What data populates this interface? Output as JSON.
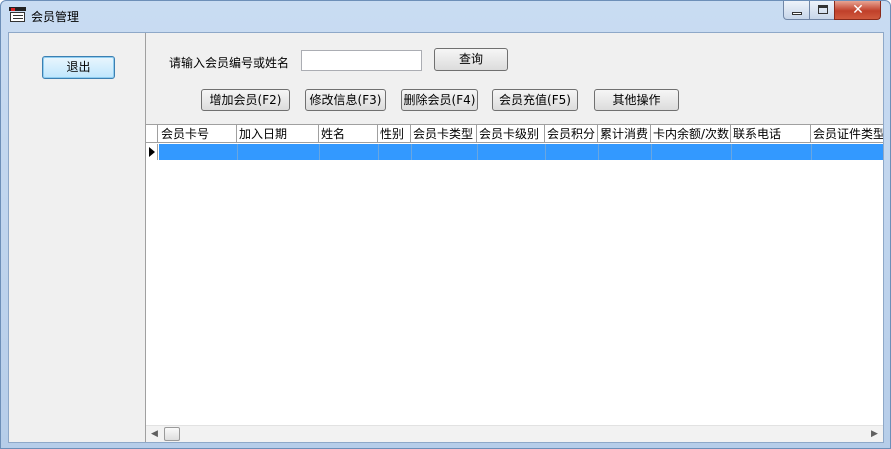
{
  "window": {
    "title": "会员管理",
    "icon": "app-window-icon",
    "controls": {
      "minimize": "minimize-icon",
      "maximize": "maximize-icon",
      "close_glyph": "✕"
    }
  },
  "left_panel": {
    "exit_label": "退出"
  },
  "search": {
    "label": "请输入会员编号或姓名",
    "value": "",
    "placeholder": "",
    "query_label": "查询"
  },
  "toolbar": {
    "add_label": "增加会员(F2)",
    "edit_label": "修改信息(F3)",
    "delete_label": "删除会员(F4)",
    "recharge_label": "会员充值(F5)",
    "other_label": "其他操作"
  },
  "grid": {
    "columns": [
      "会员卡号",
      "加入日期",
      "姓名",
      "性别",
      "会员卡类型",
      "会员卡级别",
      "会员积分",
      "累计消费",
      "卡内余额/次数",
      "联系电话",
      "会员证件类型"
    ],
    "rows": [
      {
        "selected": true,
        "cells": [
          "",
          "",
          "",
          "",
          "",
          "",
          "",
          "",
          "",
          "",
          ""
        ]
      }
    ],
    "current_row_icon": "row-pointer-icon",
    "selection_color": "#3399ff"
  },
  "scrollbar": {
    "left_glyph": "◀",
    "right_glyph": "▶"
  },
  "colors": {
    "titlebar": "#c9dcf2",
    "client_bg": "#f0f0f0",
    "close_button": "#c0402a"
  }
}
